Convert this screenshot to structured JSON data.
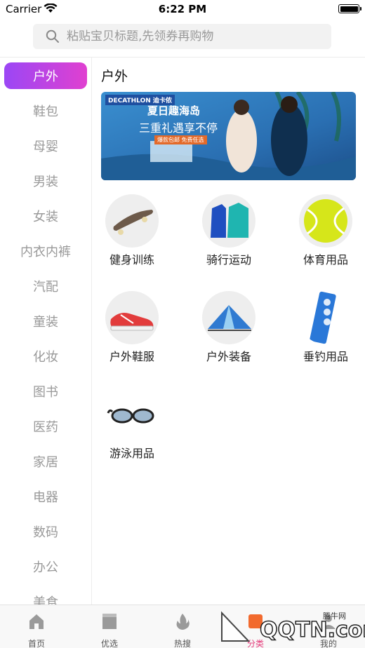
{
  "status_bar": {
    "carrier": "Carrier",
    "time": "6:22 PM"
  },
  "search": {
    "placeholder": "粘贴宝贝标题,先领券再购物"
  },
  "sidebar": {
    "items": [
      {
        "label": "户外",
        "active": true
      },
      {
        "label": "鞋包"
      },
      {
        "label": "母婴"
      },
      {
        "label": "男装"
      },
      {
        "label": "女装"
      },
      {
        "label": "内衣内裤"
      },
      {
        "label": "汽配"
      },
      {
        "label": "童装"
      },
      {
        "label": "化妆"
      },
      {
        "label": "图书"
      },
      {
        "label": "医药"
      },
      {
        "label": "家居"
      },
      {
        "label": "电器"
      },
      {
        "label": "数码"
      },
      {
        "label": "办公"
      },
      {
        "label": "美食"
      }
    ]
  },
  "content": {
    "title": "户外",
    "banner": {
      "brand": "DECATHLON 迪卡侬",
      "headline": "夏日趣海岛",
      "subline": "三重礼遇享不停",
      "tag": "爆款包邮 免费任选"
    },
    "categories": [
      {
        "label": "健身训练",
        "icon": "skateboard-icon"
      },
      {
        "label": "骑行运动",
        "icon": "cycling-jacket-icon"
      },
      {
        "label": "体育用品",
        "icon": "tennis-ball-icon"
      },
      {
        "label": "户外鞋服",
        "icon": "sneaker-icon"
      },
      {
        "label": "户外装备",
        "icon": "tent-icon"
      },
      {
        "label": "垂钓用品",
        "icon": "fishing-box-icon"
      },
      {
        "label": "游泳用品",
        "icon": "swim-goggles-icon"
      }
    ]
  },
  "tabbar": {
    "tabs": [
      {
        "label": "首页",
        "icon": "home-icon"
      },
      {
        "label": "优选",
        "icon": "shop-icon"
      },
      {
        "label": "热搜",
        "icon": "flame-icon"
      },
      {
        "label": "分类",
        "icon": "category-icon",
        "active": true
      },
      {
        "label": "我的",
        "icon": "profile-icon"
      }
    ]
  },
  "watermark": {
    "text": "QQTN.com",
    "sub": "腾牛网"
  },
  "colors": {
    "accent_start": "#9b47f5",
    "accent_end": "#e040d0",
    "tab_active": "#e53a7a"
  }
}
